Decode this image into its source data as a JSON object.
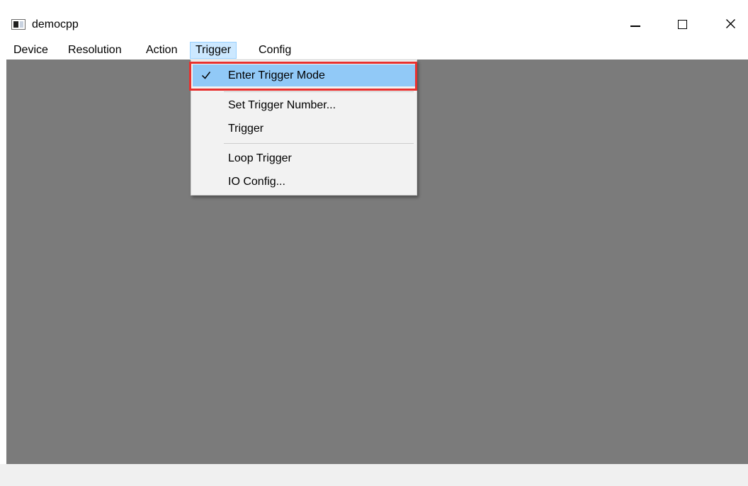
{
  "window": {
    "title": "democpp",
    "controls": {
      "minimize_icon": "minimize-icon",
      "maximize_icon": "maximize-icon",
      "close_icon": "close-icon"
    }
  },
  "menubar": {
    "items": [
      {
        "label": "Device"
      },
      {
        "label": "Resolution"
      },
      {
        "label": "Action"
      },
      {
        "label": "Trigger",
        "active": true
      },
      {
        "label": "Config"
      }
    ]
  },
  "trigger_menu": {
    "items": [
      {
        "label": "Enter Trigger Mode",
        "checked": true,
        "highlighted": true
      },
      {
        "label": "Set Trigger Number..."
      },
      {
        "label": "Trigger"
      },
      {
        "label": "Loop Trigger"
      },
      {
        "label": "IO Config..."
      }
    ]
  },
  "colors": {
    "menu_active_bg": "#cce8ff",
    "item_highlight_bg": "#91c9f7",
    "annotation_frame": "#e8312f",
    "canvas_bg": "#7b7b7b"
  }
}
